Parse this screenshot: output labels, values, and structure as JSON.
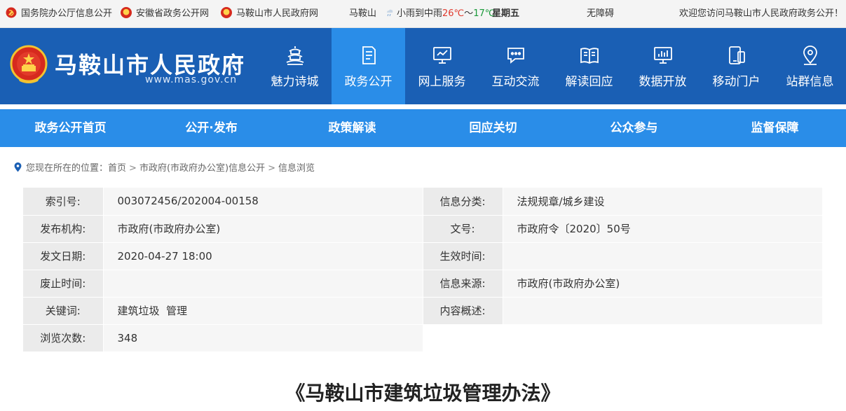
{
  "topbar": {
    "links": [
      "国务院办公厅信息公开",
      "安徽省政务公开网",
      "马鞍山市人民政府网"
    ],
    "city": "马鞍山",
    "weather": "小雨到中雨",
    "temp_high": "26℃",
    "temp_sep": "～",
    "temp_low": "17℃",
    "weekday": "星期五",
    "accessibility": "无障碍",
    "welcome": "欢迎您访问马鞍山市人民政府政务公开！"
  },
  "header": {
    "title": "马鞍山市人民政府",
    "url": "www.mas.gov.cn",
    "nav": [
      {
        "label": "魅力诗城",
        "icon": "pagoda-icon"
      },
      {
        "label": "政务公开",
        "icon": "document-icon"
      },
      {
        "label": "网上服务",
        "icon": "monitor-icon"
      },
      {
        "label": "互动交流",
        "icon": "chat-icon"
      },
      {
        "label": "解读回应",
        "icon": "book-icon"
      },
      {
        "label": "数据开放",
        "icon": "chart-icon"
      },
      {
        "label": "移动门户",
        "icon": "mobile-icon"
      },
      {
        "label": "站群信息",
        "icon": "location-icon"
      }
    ]
  },
  "subnav": [
    "政务公开首页",
    "公开·发布",
    "政策解读",
    "回应关切",
    "公众参与",
    "监督保障"
  ],
  "breadcrumb": {
    "prefix": "您现在所在的位置：",
    "items": [
      "首页",
      "市政府(市政府办公室)信息公开",
      "信息浏览"
    ],
    "sep": ">"
  },
  "info": {
    "index_label": "索引号:",
    "index_value": "003072456/202004-00158",
    "category_label": "信息分类:",
    "category_value": "法规规章/城乡建设",
    "publisher_label": "发布机构:",
    "publisher_value": "市政府(市政府办公室)",
    "docno_label": "文号:",
    "docno_value": "市政府令〔2020〕50号",
    "date_label": "发文日期:",
    "date_value": "2020-04-27 18:00",
    "effective_label": "生效时间:",
    "effective_value": "",
    "expire_label": "废止时间:",
    "expire_value": "",
    "source_label": "信息来源:",
    "source_value": "市政府(市政府办公室)",
    "keywords_label": "关键词:",
    "keywords_value": "建筑垃圾  管理",
    "summary_label": "内容概述:",
    "summary_value": "",
    "views_label": "浏览次数:",
    "views_value": "348"
  },
  "article": {
    "title": "《马鞍山市建筑垃圾管理办法》"
  },
  "colors": {
    "header_bg": "#1a5fb4",
    "accent": "#2a8de8",
    "temp_high": "#e03a2e",
    "temp_low": "#1a9a3a"
  }
}
